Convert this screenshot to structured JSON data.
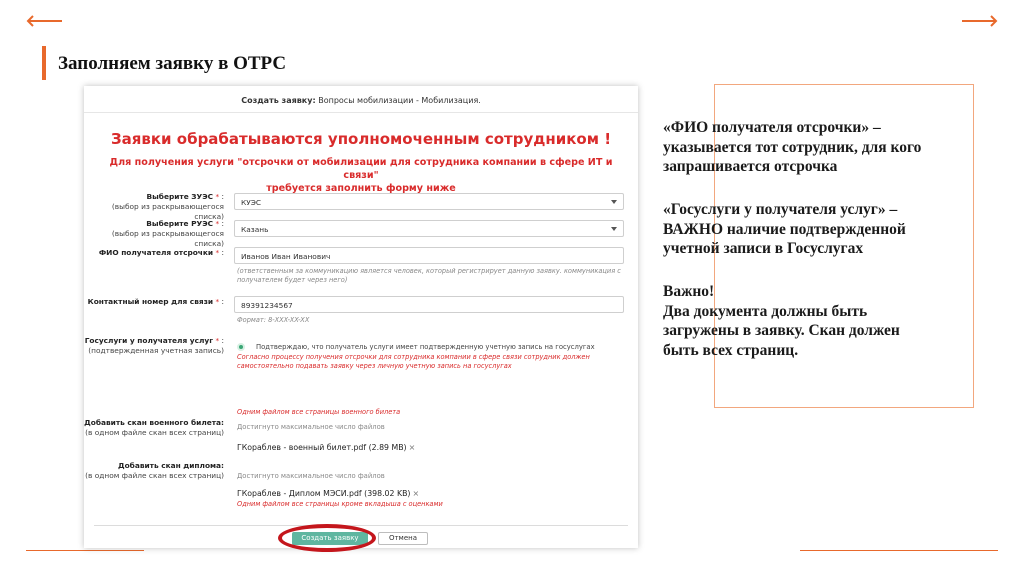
{
  "slide": {
    "title": "Заполняем заявку в ОТРС",
    "accent_color": "#e8692c",
    "highlight_color": "#c4161c"
  },
  "form": {
    "header_label": "Создать заявку:",
    "header_value": "Вопросы мобилизации - Мобилизация.",
    "warning_title": "Заявки обрабатываются уполномоченным сотрудником !",
    "warning_sub_line1": "Для получения услуги \"отсрочки от мобилизации для сотрудника компании в сфере ИТ и связи\"",
    "warning_sub_line2": "требуется заполнить форму ниже",
    "fields": {
      "zues": {
        "label": "Выберите ЗУЭС",
        "req": "*",
        "hint": "(выбор из раскрывающегося списка)",
        "value": "КУЭС"
      },
      "rues": {
        "label": "Выберите РУЭС",
        "req": "*",
        "hint": "(выбор из раскрывающегося списка)",
        "value": "Казань"
      },
      "fio": {
        "label": "ФИО получателя отсрочки",
        "req": "*",
        "value": "Иванов Иван Иванович",
        "note_line1": "(ответственным за коммуникацию является человек, который регистрирует данную заявку. коммуникация с",
        "note_line2": "получателем будет через него)"
      },
      "phone": {
        "label": "Контактный номер для связи",
        "req": "*",
        "value": "89391234567",
        "format": "Формат: 8-XXX-XX-XX"
      },
      "gosuslugi": {
        "label": "Госуслуги у получателя услуг",
        "req": "*",
        "hint": "(подтвержденная учетная запись)",
        "confirm_text": "Подтверждаю, что получатель услуги имеет подтвержденную учетную запись на госуслугах",
        "warn_line1": "Согласно процессу получения отсрочки для сотрудника компании в сфере связи сотрудник должен",
        "warn_line2": "самостоятельно подавать заявку через личную учетную запись на госуслугах"
      },
      "military_id": {
        "label": "Добавить скан военного билета:",
        "hint": "(в одном файле скан всех страниц)",
        "note": "Одним файлом все страницы военного билета",
        "limit": "Достигнуто максимальное число файлов",
        "file": "ГКораблев - военный билет.pdf (2.89 MB)"
      },
      "diploma": {
        "label": "Добавить скан диплома:",
        "hint": "(в одном файле скан всех страниц)",
        "limit": "Достигнуто максимальное число файлов",
        "file": "ГКораблев - Диплом МЭСИ.pdf (398.02 KB)",
        "note": "Одним файлом все страницы кроме вкладыша с оценками"
      }
    },
    "remove_glyph": "×",
    "submit_label": "Создать заявку",
    "cancel_label": "Отмена"
  },
  "info": {
    "p1_line1": "«ФИО получателя отсрочки» –",
    "p1_line2": "указывается тот сотрудник, для кого",
    "p1_line3": "запрашивается отсрочка",
    "p2_line1": "«Госуслуги у получателя услуг» –",
    "p2_line2": "ВАЖНО наличие подтвержденной",
    "p2_line3": "учетной записи в Госуслугах",
    "p3_line1": "Важно!",
    "p3_line2": "Два документа должны быть",
    "p3_line3": "загружены в заявку. Скан должен",
    "p3_line4": "быть всех страниц."
  }
}
